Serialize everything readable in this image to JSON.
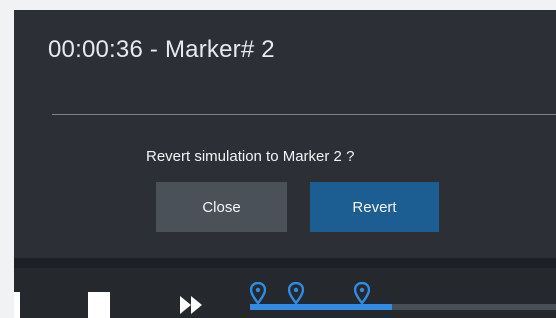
{
  "dialog": {
    "title": "00:00:36 - Marker# 2",
    "message": "Revert simulation to Marker 2 ?",
    "close_label": "Close",
    "revert_label": "Revert"
  },
  "player": {
    "controls": [
      "stop-icon",
      "fast-forward-icon"
    ],
    "markers": [
      "marker-pin-icon",
      "marker-pin-icon",
      "marker-pin-icon"
    ]
  },
  "colors": {
    "dialog_bg": "#2c3036",
    "close_button": "#4b5159",
    "revert_button": "#1c5e91",
    "timeline_accent": "#2f8be4",
    "player_bg": "#25292e"
  }
}
